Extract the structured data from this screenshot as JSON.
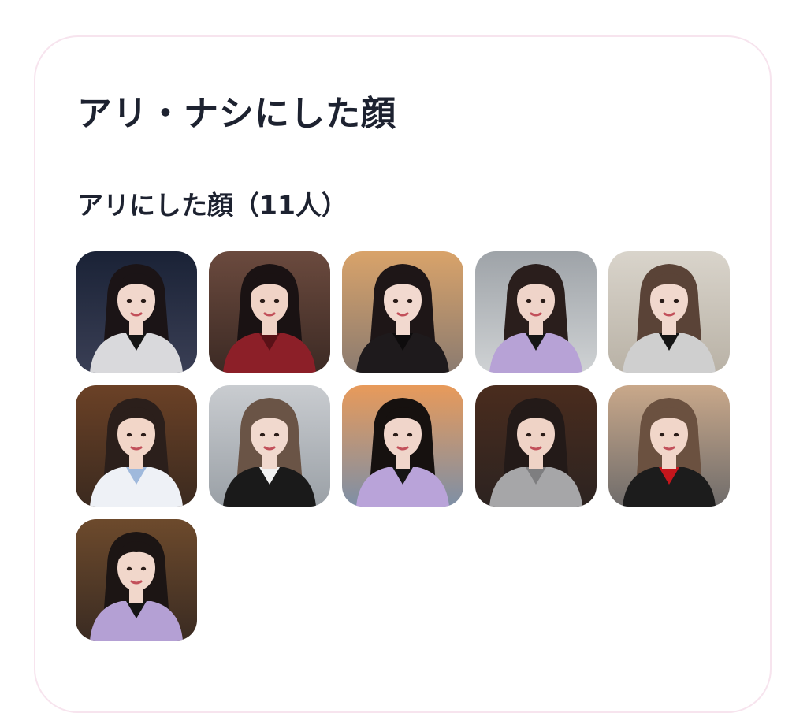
{
  "page": {
    "title": "アリ・ナシにした顔"
  },
  "section": {
    "title": "アリにした顔（11人）"
  },
  "faces": [
    {
      "bg_top": "#1a2236",
      "bg_bottom": "#3a3f55",
      "hair": "#1b1416",
      "skin": "#f1d7cc",
      "top": "#d9d9dc",
      "accent": "#151515"
    },
    {
      "bg_top": "#6b4a3e",
      "bg_bottom": "#3c2a24",
      "hair": "#1a1213",
      "skin": "#f0d3c6",
      "top": "#8c1f28",
      "accent": "#5a1117"
    },
    {
      "bg_top": "#d9a36a",
      "bg_bottom": "#8b7b70",
      "hair": "#1e1617",
      "skin": "#f2d9cf",
      "top": "#1e1a1c",
      "accent": "#0e0c0d"
    },
    {
      "bg_top": "#9ea3a8",
      "bg_bottom": "#cfd2d4",
      "hair": "#2a1e1c",
      "skin": "#efd4c9",
      "top": "#b7a2d6",
      "accent": "#151515"
    },
    {
      "bg_top": "#d9d4cb",
      "bg_bottom": "#b9b2a6",
      "hair": "#5a4337",
      "skin": "#f1d8cd",
      "top": "#cfcfcf",
      "accent": "#151515"
    },
    {
      "bg_top": "#6b4126",
      "bg_bottom": "#3b2a1f",
      "hair": "#2b1f1b",
      "skin": "#f2d6c8",
      "top": "#eef1f6",
      "accent": "#9fb9dc"
    },
    {
      "bg_top": "#c9ccd0",
      "bg_bottom": "#9aa0a6",
      "hair": "#6a5446",
      "skin": "#f1d9ce",
      "top": "#1a1a1a",
      "accent": "#f2f2f2"
    },
    {
      "bg_top": "#e89a5a",
      "bg_bottom": "#7d8fa6",
      "hair": "#16110f",
      "skin": "#f0d5ca",
      "top": "#b9a3d9",
      "accent": "#151515"
    },
    {
      "bg_top": "#4a2c1e",
      "bg_bottom": "#2c2320",
      "hair": "#231a18",
      "skin": "#efd3c6",
      "top": "#a6a6a8",
      "accent": "#7e7e80"
    },
    {
      "bg_top": "#c9a88a",
      "bg_bottom": "#6f6c6b",
      "hair": "#6b5140",
      "skin": "#f1d6c9",
      "top": "#1c1c1c",
      "accent": "#c4161c"
    },
    {
      "bg_top": "#6d4a2c",
      "bg_bottom": "#3a2b22",
      "hair": "#1c1514",
      "skin": "#f1d7cb",
      "top": "#b4a0d4",
      "accent": "#151515"
    }
  ]
}
